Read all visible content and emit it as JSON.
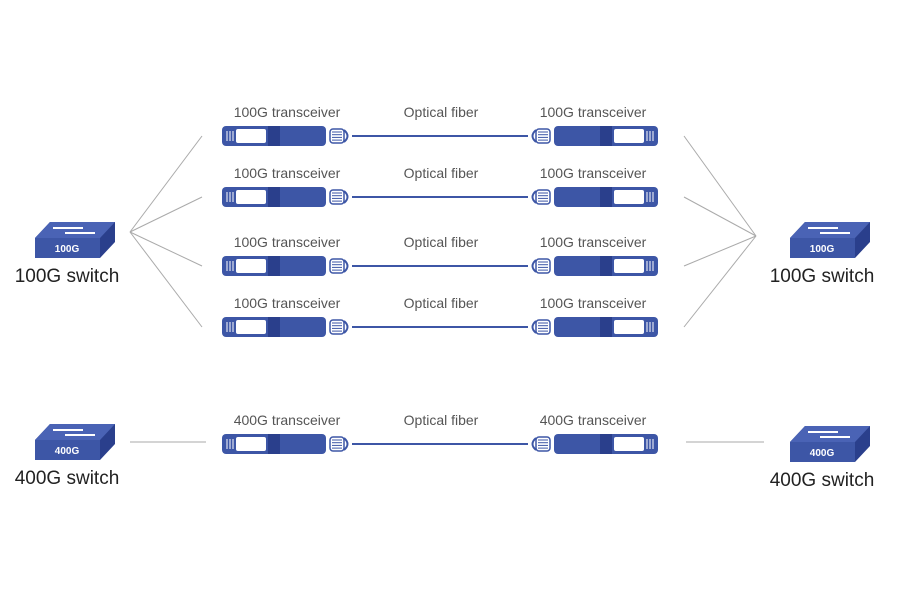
{
  "colors": {
    "transceiver": "#3d56a6",
    "transceiver_dark": "#2a3f8c",
    "link_line": "#aaaaaa",
    "fiber": "#3d56a6"
  },
  "rows_100g": [
    {
      "left_label": "100G transceiver",
      "fiber_label": "Optical fiber",
      "right_label": "100G transceiver"
    },
    {
      "left_label": "100G transceiver",
      "fiber_label": "Optical fiber",
      "right_label": "100G transceiver"
    },
    {
      "left_label": "100G transceiver",
      "fiber_label": "Optical fiber",
      "right_label": "100G transceiver"
    },
    {
      "left_label": "100G transceiver",
      "fiber_label": "Optical fiber",
      "right_label": "100G transceiver"
    }
  ],
  "row_400g": {
    "left_label": "400G transceiver",
    "fiber_label": "Optical fiber",
    "right_label": "400G transceiver"
  },
  "switches": {
    "left_100": {
      "tag": "100G",
      "label": "100G switch"
    },
    "right_100": {
      "tag": "100G",
      "label": "100G switch"
    },
    "left_400": {
      "tag": "400G",
      "label": "400G switch"
    },
    "right_400": {
      "tag": "400G",
      "label": "400G switch"
    }
  }
}
